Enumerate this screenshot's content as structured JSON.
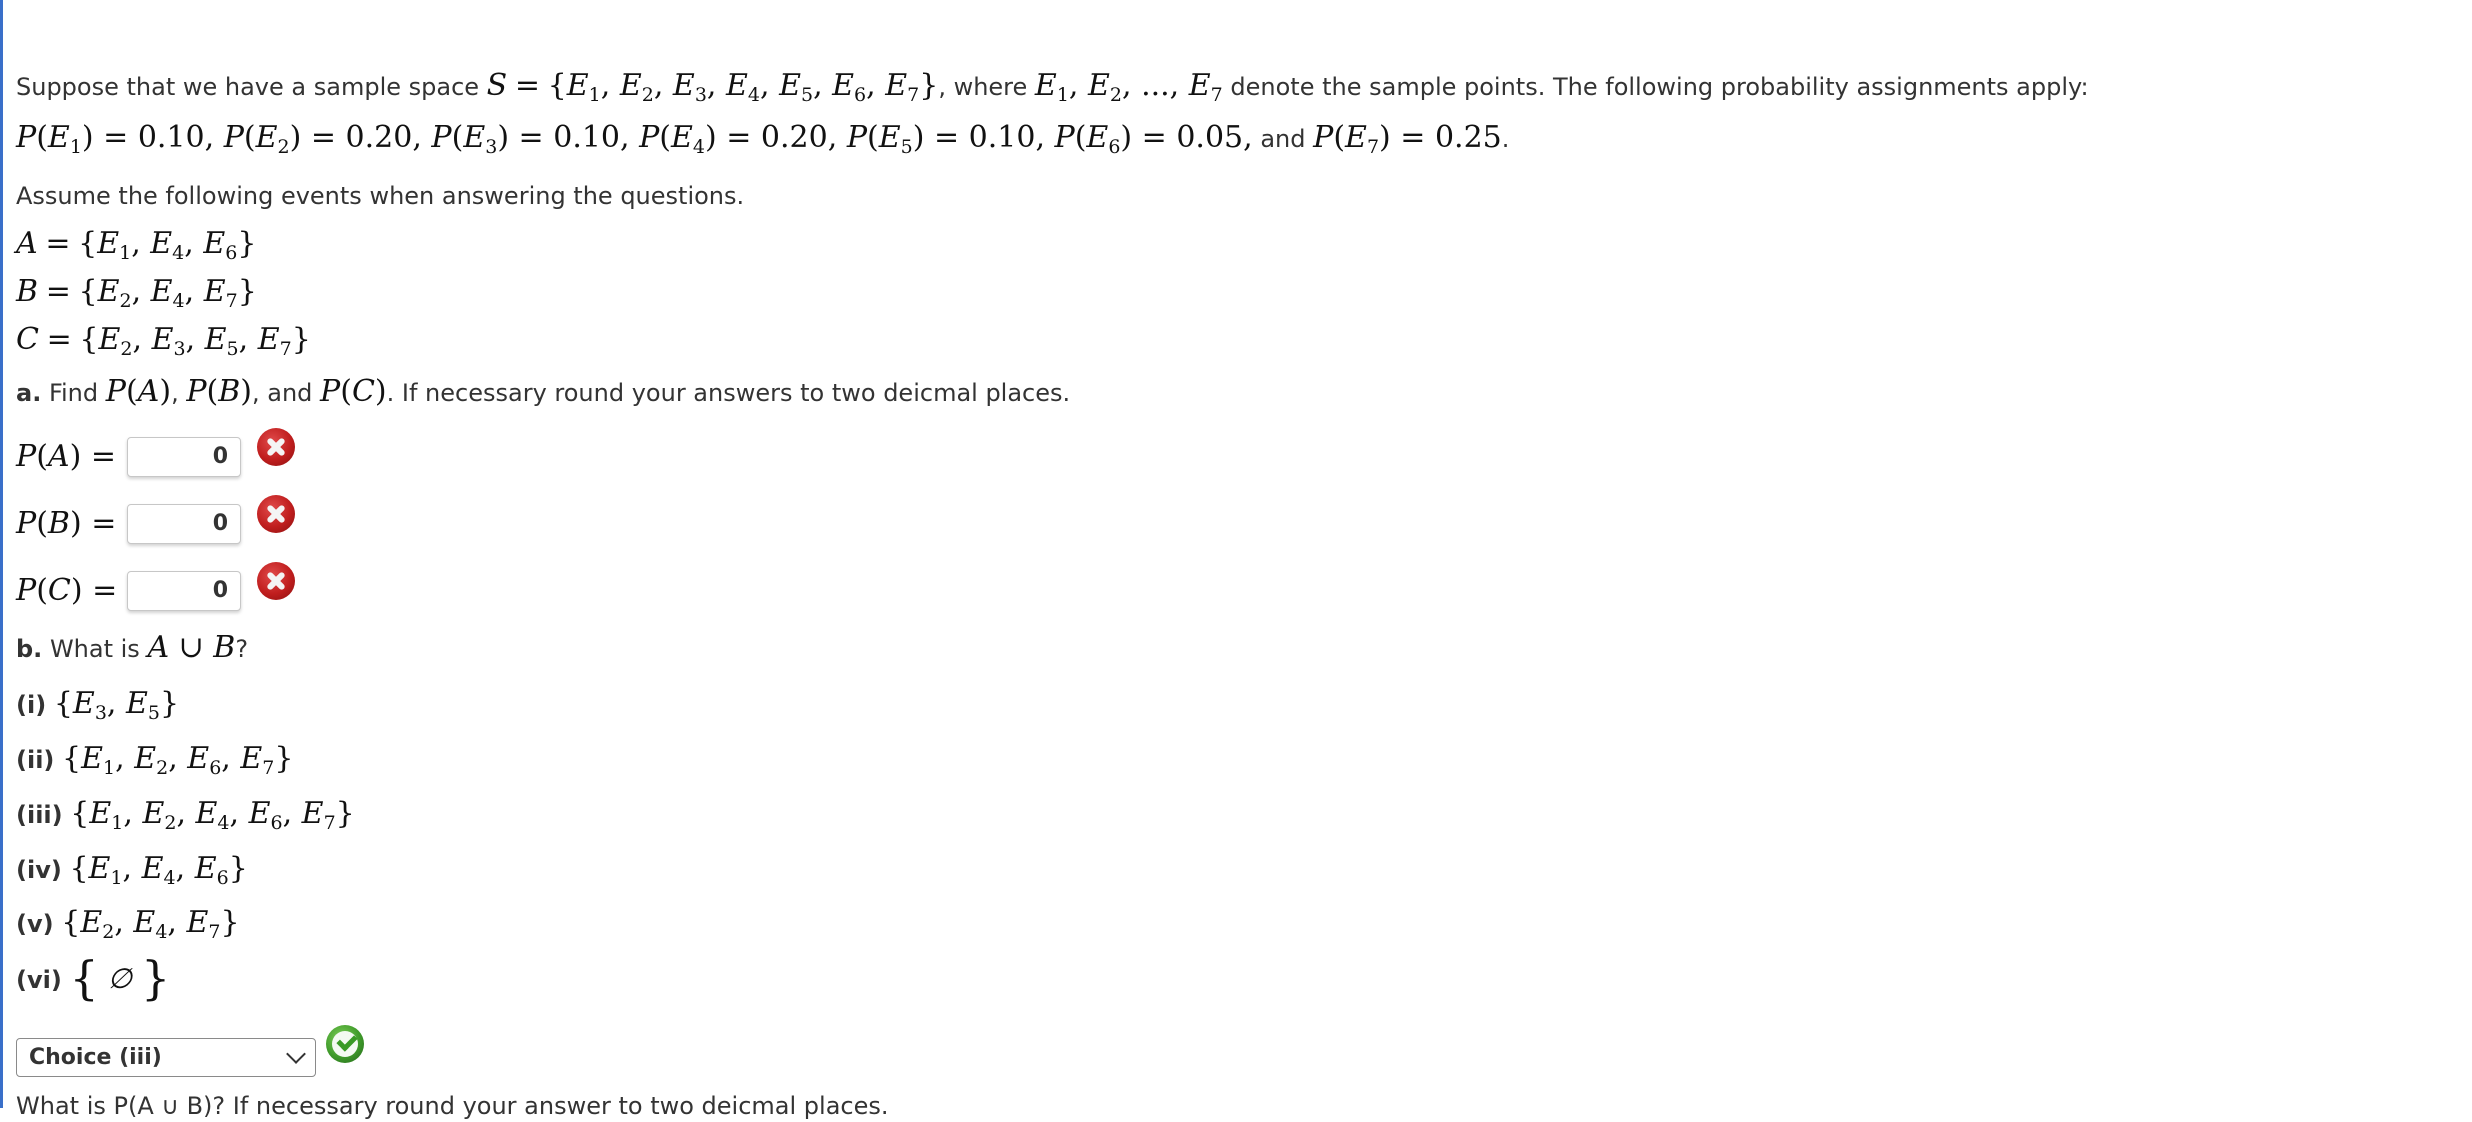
{
  "intro": {
    "sentence_prefix": "Suppose that we have a sample space",
    "sample_space": "S = {E1, E2, E3, E4, E5, E6, E7}",
    "sentence_middle": ", where",
    "sample_points": "E1, E2, ..., E7",
    "sentence_suffix": "denote the sample points. The following probability assignments apply:"
  },
  "probabilities": [
    {
      "event": "E1",
      "value": "0.10"
    },
    {
      "event": "E2",
      "value": "0.20"
    },
    {
      "event": "E3",
      "value": "0.10"
    },
    {
      "event": "E4",
      "value": "0.20"
    },
    {
      "event": "E5",
      "value": "0.10"
    },
    {
      "event": "E6",
      "value": "0.05"
    },
    {
      "event": "E7",
      "value": "0.25"
    }
  ],
  "probabilities_text": {
    "and": "and",
    "end": "."
  },
  "assume_text": "Assume the following events when answering the questions.",
  "events": [
    {
      "name": "A",
      "members": [
        "E1",
        "E4",
        "E6"
      ]
    },
    {
      "name": "B",
      "members": [
        "E2",
        "E4",
        "E7"
      ]
    },
    {
      "name": "C",
      "members": [
        "E2",
        "E3",
        "E5",
        "E7"
      ]
    }
  ],
  "part_a": {
    "label": "a.",
    "prefix": "Find",
    "terms": [
      "P(A)",
      "P(B)",
      "P(C)"
    ],
    "and": "and",
    "suffix": ". If necessary round your answers to two deicmal places.",
    "answers": [
      {
        "label": "P(A) =",
        "value": "0",
        "status": "incorrect"
      },
      {
        "label": "P(B) =",
        "value": "0",
        "status": "incorrect"
      },
      {
        "label": "P(C) =",
        "value": "0",
        "status": "incorrect"
      }
    ]
  },
  "part_b": {
    "label": "b.",
    "question_prefix": "What is",
    "expression": "A ∪ B",
    "question_suffix": "?",
    "choices": [
      {
        "label": "(i)",
        "members": [
          "E3",
          "E5"
        ]
      },
      {
        "label": "(ii)",
        "members": [
          "E1",
          "E2",
          "E6",
          "E7"
        ]
      },
      {
        "label": "(iii)",
        "members": [
          "E1",
          "E2",
          "E4",
          "E6",
          "E7"
        ]
      },
      {
        "label": "(iv)",
        "members": [
          "E1",
          "E4",
          "E6"
        ]
      },
      {
        "label": "(v)",
        "members": [
          "E2",
          "E4",
          "E7"
        ]
      },
      {
        "label": "(vi)",
        "empty_set": "∅"
      }
    ],
    "selected": "Choice (iii)",
    "status": "correct",
    "followup": "What is P(A ∪ B)? If necessary round your answer to two deicmal places."
  },
  "colors": {
    "accent_border": "#3a6fc9",
    "incorrect": "#c01e1e",
    "correct": "#3f9a2a",
    "text": "#333333"
  }
}
